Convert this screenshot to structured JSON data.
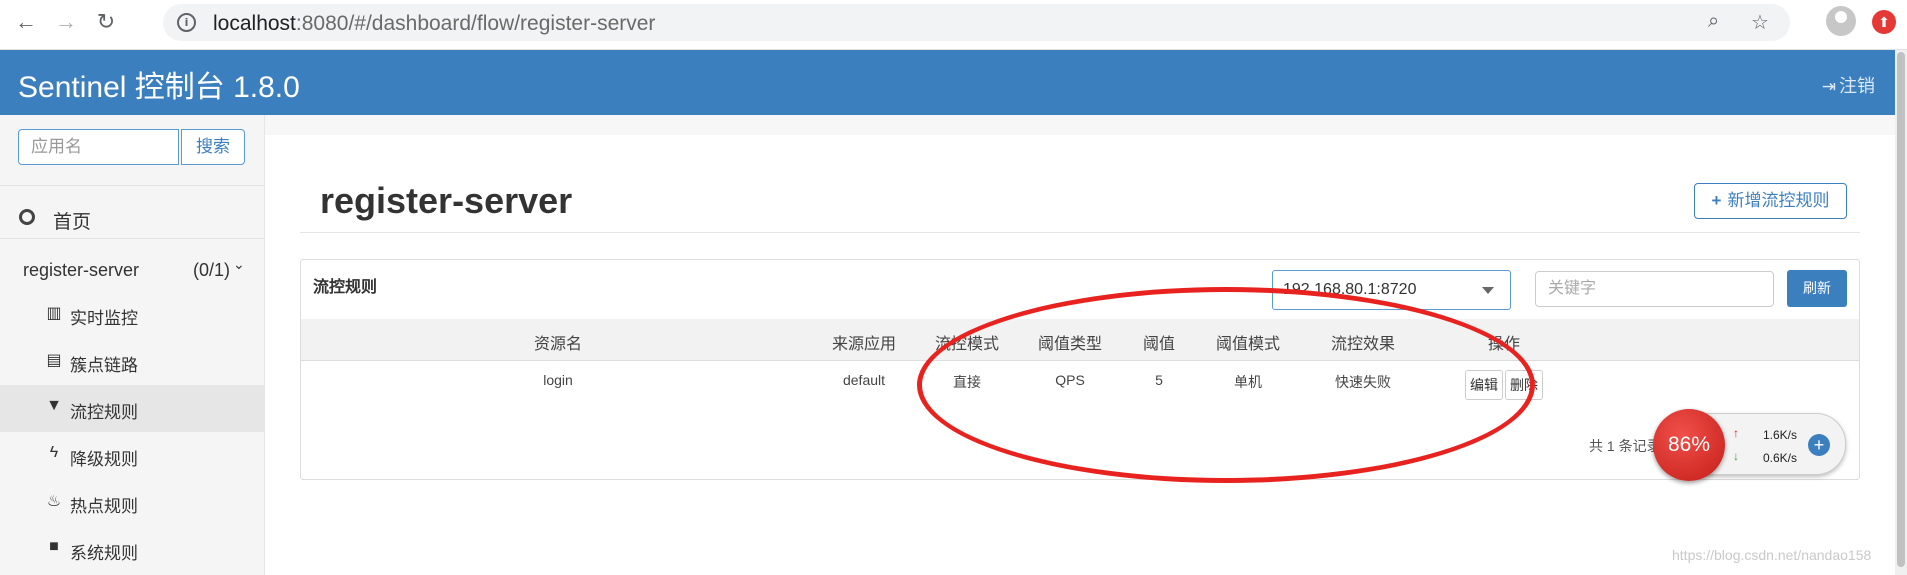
{
  "browser": {
    "url_host": "localhost",
    "url_rest": ":8080/#/dashboard/flow/register-server"
  },
  "header": {
    "title": "Sentinel 控制台 1.8.0",
    "logout_label": "注销"
  },
  "sidebar": {
    "search_placeholder": "应用名",
    "search_button": "搜索",
    "home_label": "首页",
    "app": {
      "name": "register-server",
      "count": "(0/1)"
    },
    "items": [
      {
        "label": "实时监控",
        "icon": "bar-chart-icon"
      },
      {
        "label": "簇点链路",
        "icon": "list-icon"
      },
      {
        "label": "流控规则",
        "icon": "filter-icon",
        "active": true
      },
      {
        "label": "降级规则",
        "icon": "flash-icon"
      },
      {
        "label": "热点规则",
        "icon": "fire-icon"
      },
      {
        "label": "系统规则",
        "icon": "lock-icon"
      }
    ]
  },
  "main": {
    "page_title": "register-server",
    "add_button": "新增流控规则",
    "panel": {
      "title": "流控规则",
      "machine": "192.168.80.1:8720",
      "keyword_placeholder": "关键字",
      "refresh": "刷新"
    },
    "table": {
      "columns": [
        "资源名",
        "来源应用",
        "流控模式",
        "阈值类型",
        "阈值",
        "阈值模式",
        "流控效果",
        "操作"
      ],
      "rows": [
        {
          "resource": "login",
          "limitApp": "default",
          "strategy": "直接",
          "grade": "QPS",
          "count": "5",
          "cluster": "单机",
          "effect": "快速失败",
          "edit": "编辑",
          "delete": "删除"
        }
      ],
      "pager": "共 1 条记录"
    }
  },
  "speed_widget": {
    "percent": "86%",
    "up": "1.6K/s",
    "down": "0.6K/s"
  },
  "watermark": "https://blog.csdn.net/nandao158"
}
